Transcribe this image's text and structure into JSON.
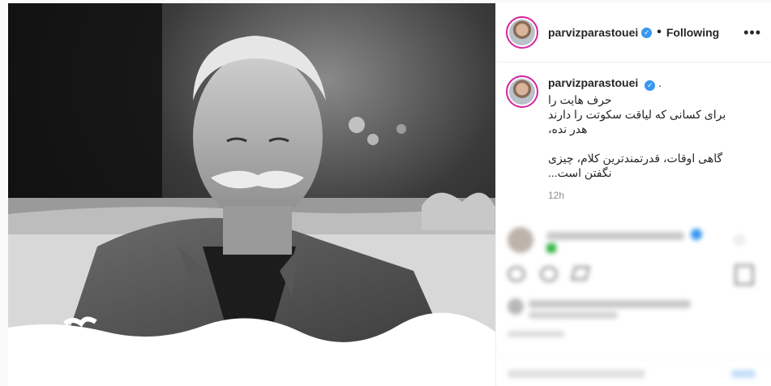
{
  "post": {
    "username": "parvizparastouei",
    "follow_status": "Following",
    "more_label": "•••",
    "caption_username": "parvizparastouei",
    "caption_suffix": ".",
    "caption_text": "حرف هایت را\nبرای کسانی که لیاقت سکوتت را دارند\nهدر نده،\n\nگاهی اوقات، قدرتمندترین کلام، چیزی\nنگفتن است...",
    "timestamp": "12h"
  },
  "colors": {
    "verified": "#3897f0",
    "story_ring": "#d6249f",
    "accent_blurred_badge": "#3ab54a"
  },
  "icons": [
    "verified-badge-icon",
    "more-options-icon",
    "heart-icon",
    "comment-icon",
    "share-icon",
    "save-icon"
  ]
}
